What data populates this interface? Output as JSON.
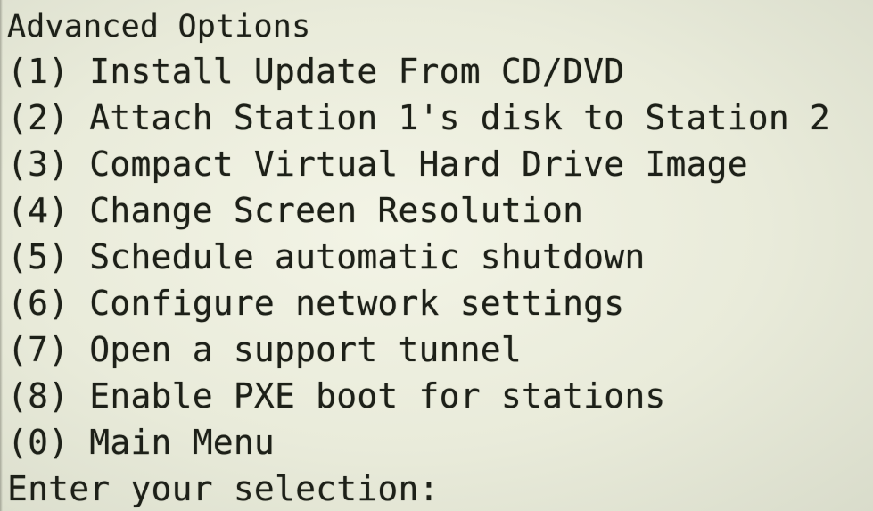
{
  "screen": {
    "title": "Advanced Options",
    "menu_items": [
      {
        "label": "(1) Install Update From CD/DVD"
      },
      {
        "label": "(2) Attach Station 1's disk to Station 2"
      },
      {
        "label": "(3) Compact Virtual Hard Drive Image"
      },
      {
        "label": "(4) Change Screen Resolution"
      },
      {
        "label": "(5) Schedule automatic shutdown"
      },
      {
        "label": "(6) Configure network settings"
      },
      {
        "label": "(7) Open a support tunnel"
      },
      {
        "label": "(8) Enable PXE boot for stations"
      },
      {
        "label": "(0) Main Menu"
      }
    ],
    "prompt": "Enter your selection:"
  },
  "colors": {
    "background": "#e9ebda",
    "text": "#1d2018"
  }
}
